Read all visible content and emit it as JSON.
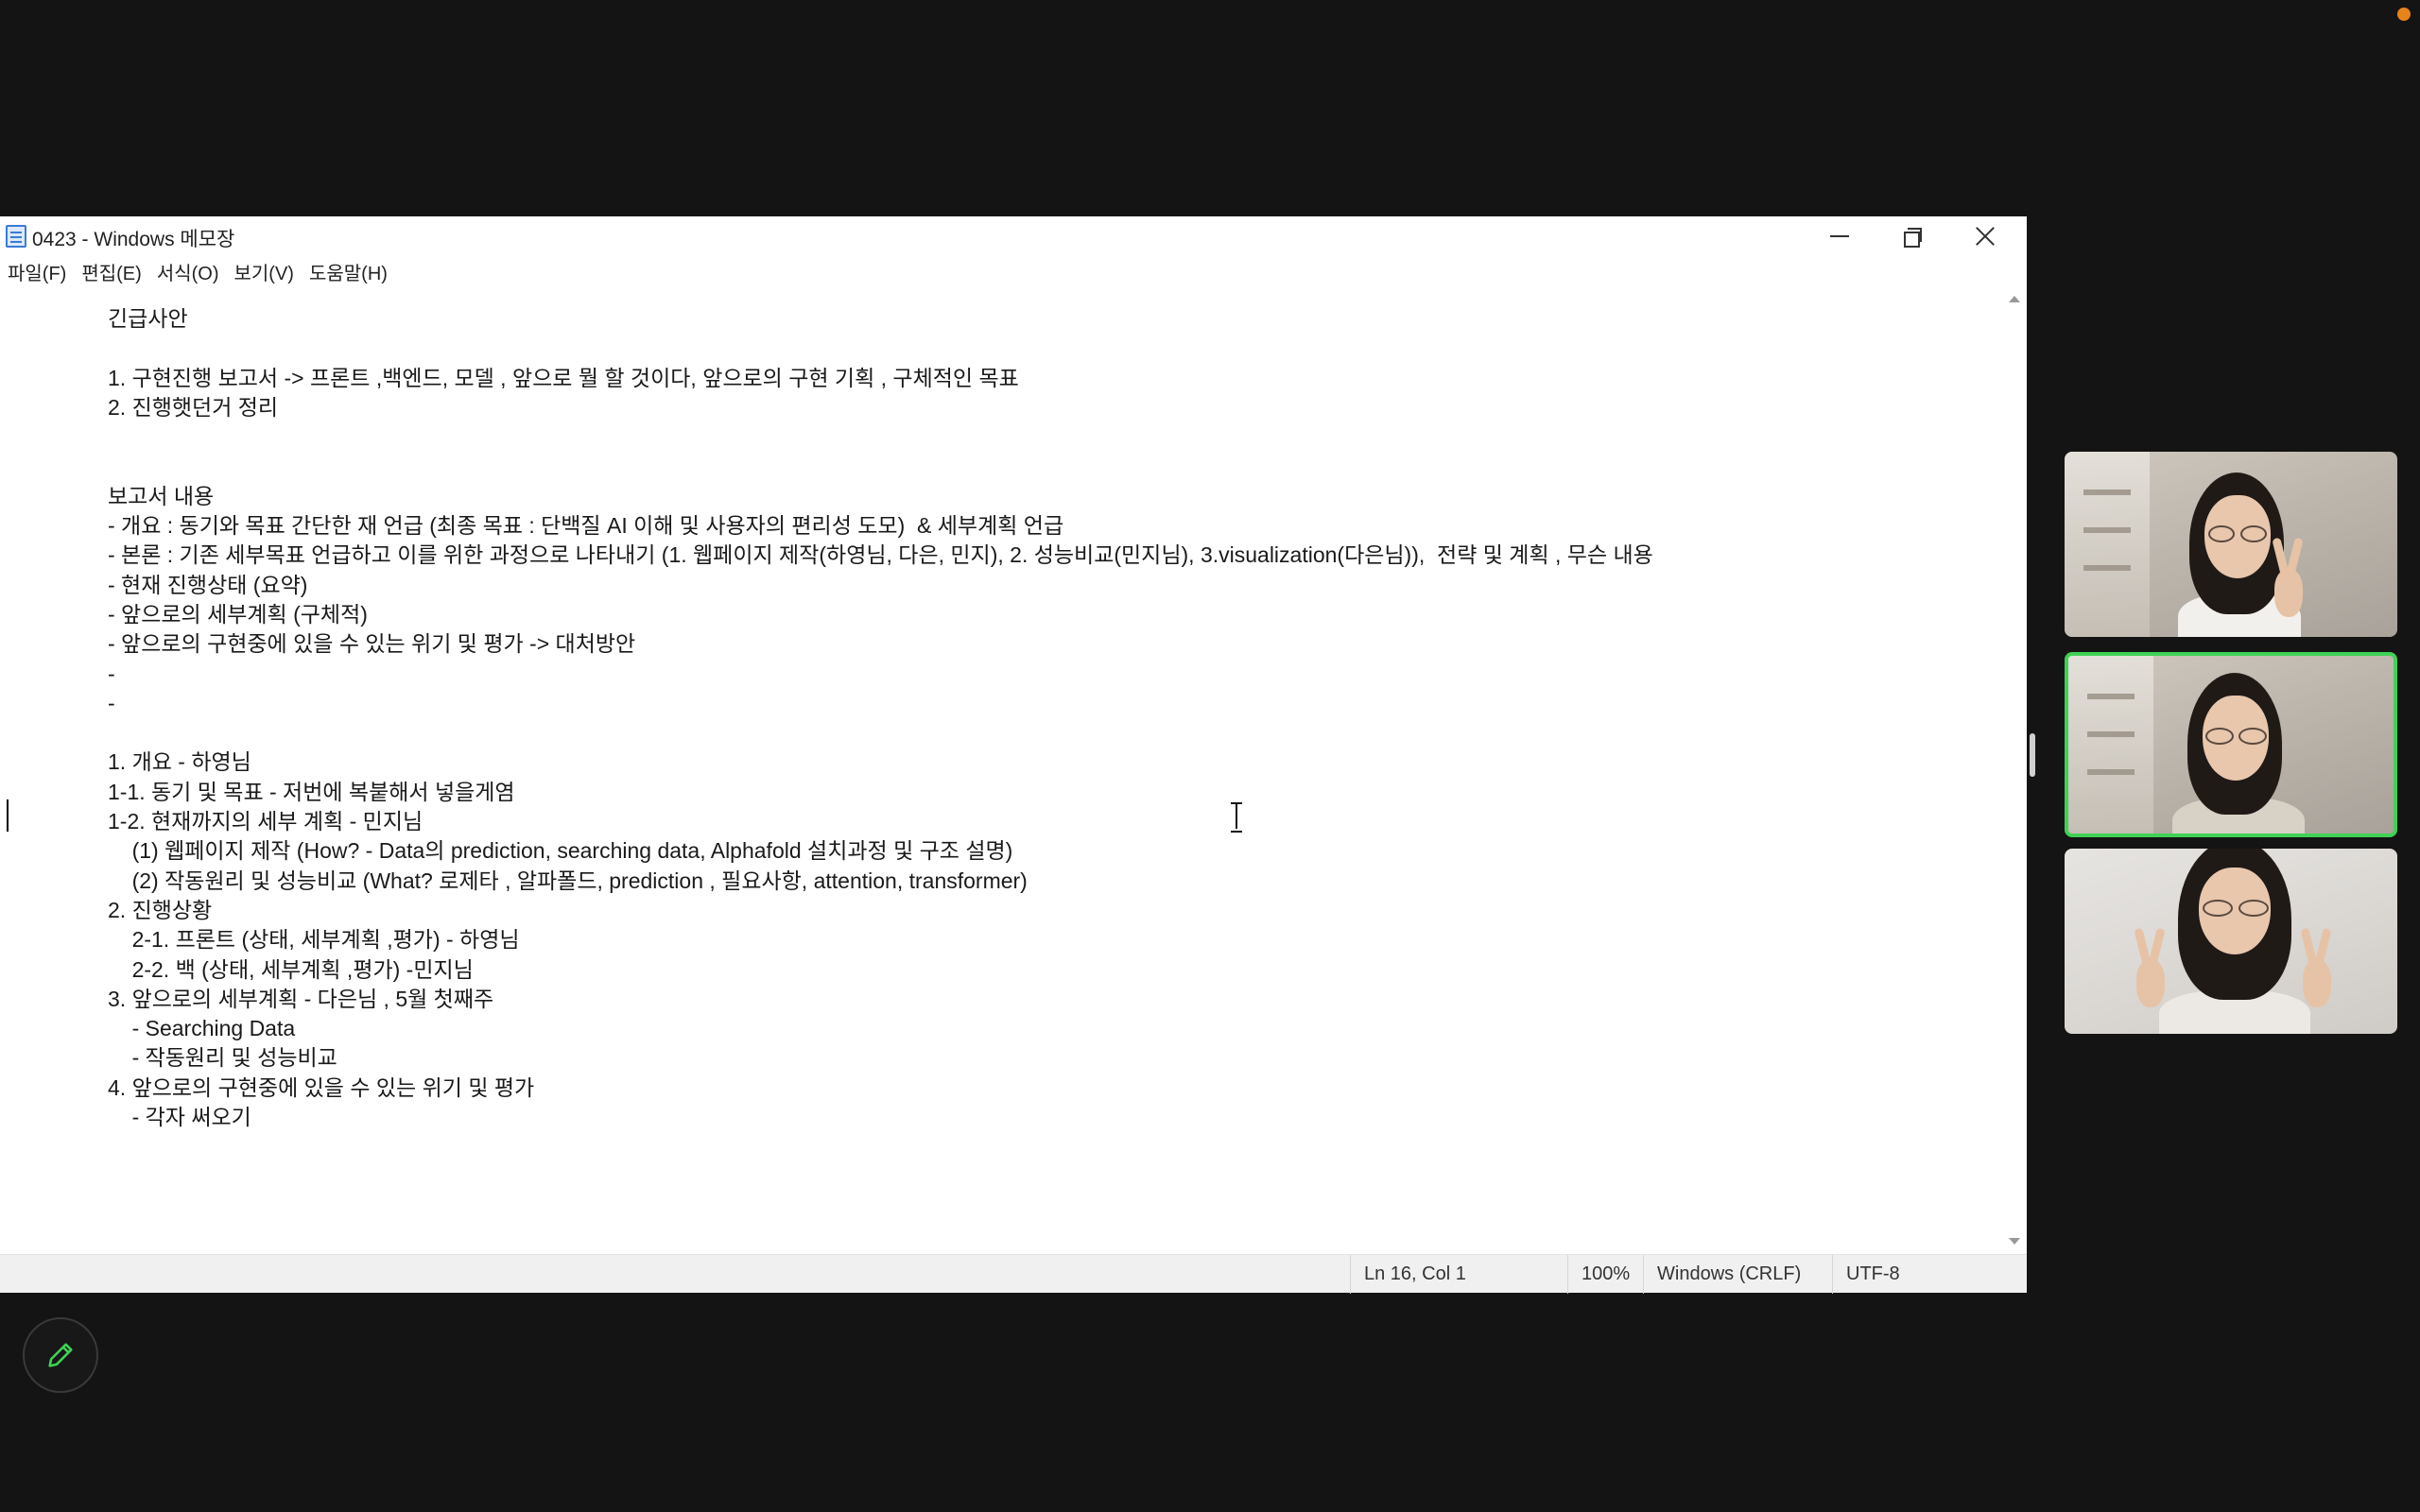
{
  "window": {
    "title": "0423 - Windows 메모장"
  },
  "menu": [
    {
      "label": "파일(F)"
    },
    {
      "label": "편집(E)"
    },
    {
      "label": "서식(O)"
    },
    {
      "label": "보기(V)"
    },
    {
      "label": "도움말(H)"
    }
  ],
  "document": {
    "text": "긴급사안\n\n1. 구현진행 보고서 -> 프론트 ,백엔드, 모델 , 앞으로 뭘 할 것이다, 앞으로의 구현 기획 , 구체적인 목표\n2. 진행햇던거 정리\n\n\n보고서 내용\n- 개요 : 동기와 목표 간단한 재 언급 (최종 목표 : 단백질 AI 이해 및 사용자의 편리성 도모)  & 세부계획 언급\n- 본론 : 기존 세부목표 언급하고 이를 위한 과정으로 나타내기 (1. 웹페이지 제작(하영님, 다은, 민지), 2. 성능비교(민지님), 3.visualization(다은님)),  전략 및 계획 , 무슨 내용\n- 현재 진행상태 (요약)\n- 앞으로의 세부계획 (구체적)\n- 앞으로의 구현중에 있을 수 있는 위기 및 평가 -> 대처방안\n-\n-\n\n1. 개요 - 하영님\n1-1. 동기 및 목표 - 저번에 복붙해서 넣을게염\n1-2. 현재까지의 세부 계획 - 민지님\n\t(1) 웹페이지 제작 (How? - Data의 prediction, searching data, Alphafold 설치과정 및 구조 설명)\n\t(2) 작동원리 및 성능비교 (What? 로제타 , 알파폴드, prediction , 필요사항, attention, transformer)\n2. 진행상황\n\t2-1. 프론트 (상태, 세부계획 ,평가) - 하영님\n\t2-2. 백 (상태, 세부계획 ,평가) -민지님\n3. 앞으로의 세부계획 - 다은님 , 5월 첫째주\n\t- Searching Data\n\t- 작동원리 및 성능비교\n4. 앞으로의 구현중에 있을 수 있는 위기 및 평가\n\t- 각자 써오기"
  },
  "status": {
    "position": "Ln 16, Col 1",
    "zoom": "100%",
    "line_ending": "Windows (CRLF)",
    "encoding": "UTF-8"
  },
  "participants": [
    {
      "icon": "video-feed-participant-1"
    },
    {
      "icon": "video-feed-participant-2",
      "active_speaker": true
    },
    {
      "icon": "video-feed-participant-3"
    }
  ],
  "colors": {
    "background": "#141414",
    "active_speaker_border": "#3fd255",
    "recording_dot": "#e8821a"
  },
  "icons": {
    "annotate": "pencil-icon",
    "app": "notepad-icon",
    "minimize": "minimize-icon",
    "restore": "restore-icon",
    "close": "close-icon"
  }
}
